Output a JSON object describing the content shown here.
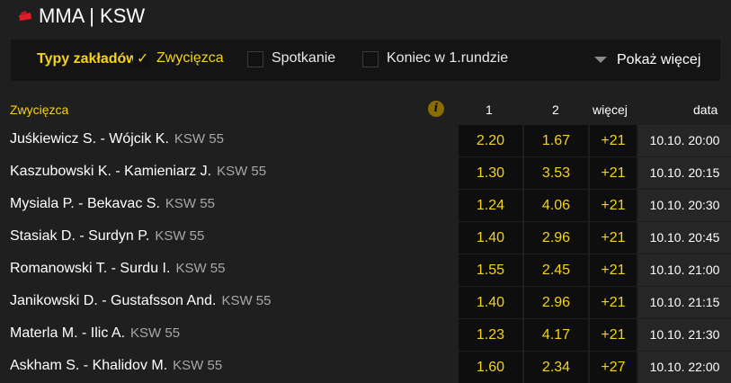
{
  "header": {
    "title": "MMA | KSW"
  },
  "filters": {
    "label": "Typy zakładów",
    "options": [
      {
        "label": "Zwycięzca",
        "checked": true
      },
      {
        "label": "Spotkanie",
        "checked": false
      },
      {
        "label": "Koniec w 1.rundzie",
        "checked": false
      }
    ],
    "more_label": "Pokaż więcej"
  },
  "table": {
    "market": "Zwycięzca",
    "columns": [
      "1",
      "2",
      "więcej",
      "data"
    ],
    "rows": [
      {
        "match": "Juśkiewicz S. - Wójcik K.",
        "league": "KSW 55",
        "odd1": "2.20",
        "odd2": "1.67",
        "more": "+21",
        "date": "10.10. 20:00"
      },
      {
        "match": "Kaszubowski K. - Kamieniarz J.",
        "league": "KSW 55",
        "odd1": "1.30",
        "odd2": "3.53",
        "more": "+21",
        "date": "10.10. 20:15"
      },
      {
        "match": "Mysiala P. - Bekavac S.",
        "league": "KSW 55",
        "odd1": "1.24",
        "odd2": "4.06",
        "more": "+21",
        "date": "10.10. 20:30"
      },
      {
        "match": "Stasiak D. - Surdyn P.",
        "league": "KSW 55",
        "odd1": "1.40",
        "odd2": "2.96",
        "more": "+21",
        "date": "10.10. 20:45"
      },
      {
        "match": "Romanowski T. - Surdu I.",
        "league": "KSW 55",
        "odd1": "1.55",
        "odd2": "2.45",
        "more": "+21",
        "date": "10.10. 21:00"
      },
      {
        "match": "Janikowski D. - Gustafsson And.",
        "league": "KSW 55",
        "odd1": "1.40",
        "odd2": "2.96",
        "more": "+21",
        "date": "10.10. 21:15"
      },
      {
        "match": "Materla M. - Ilic A.",
        "league": "KSW 55",
        "odd1": "1.23",
        "odd2": "4.17",
        "more": "+21",
        "date": "10.10. 21:30"
      },
      {
        "match": "Askham S. - Khalidov M.",
        "league": "KSW 55",
        "odd1": "1.60",
        "odd2": "2.34",
        "more": "+27",
        "date": "10.10. 22:00"
      }
    ]
  }
}
